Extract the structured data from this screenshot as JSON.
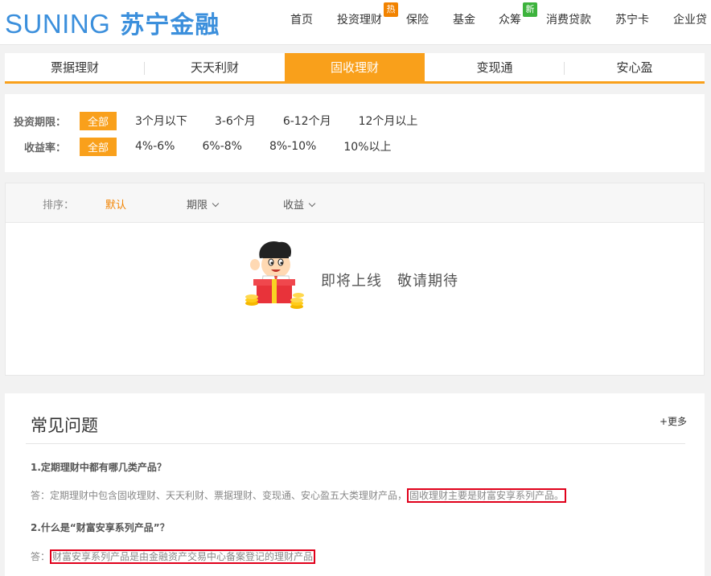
{
  "brand": {
    "name_en": "SUNING",
    "name_cn": "苏宁金融",
    "color": "#3b8fdc"
  },
  "nav": {
    "items": [
      "首页",
      "投资理财",
      "保险",
      "基金",
      "众筹",
      "消费贷款",
      "苏宁卡",
      "企业贷"
    ],
    "badge_hot": "热",
    "badge_new": "新"
  },
  "tabs": [
    "票据理财",
    "天天利财",
    "固收理财",
    "变现通",
    "安心盈"
  ],
  "active_tab": "固收理财",
  "accent": "#f9a01b",
  "filter": {
    "period_label": "投资期限：",
    "period_options": [
      "全部",
      "3个月以下",
      "3-6个月",
      "6-12个月",
      "12个月以上"
    ],
    "rate_label": "收益率：",
    "rate_options": [
      "全部",
      "4%-6%",
      "6%-8%",
      "8%-10%",
      "10%以上"
    ]
  },
  "sort": {
    "label": "排序：",
    "default": "默认",
    "period": "期限",
    "yield": "收益"
  },
  "empty_message": "即将上线　敬请期待",
  "faq": {
    "title": "常见问题",
    "more": "+更多",
    "q1": "1.定期理财中都有哪几类产品？",
    "a1_prefix": "答：定期理财中包含固收理财、天天利财、票据理财、变现通、安心盈五大类理财产品，",
    "a1_highlight": "固收理财主要是财富安享系列产品。",
    "q2": "2.什么是“财富安享系列产品”？",
    "a2_prefix": "答：",
    "a2_highlight": "财富安享系列产品是由金融资产交易中心备案登记的理财产品"
  }
}
